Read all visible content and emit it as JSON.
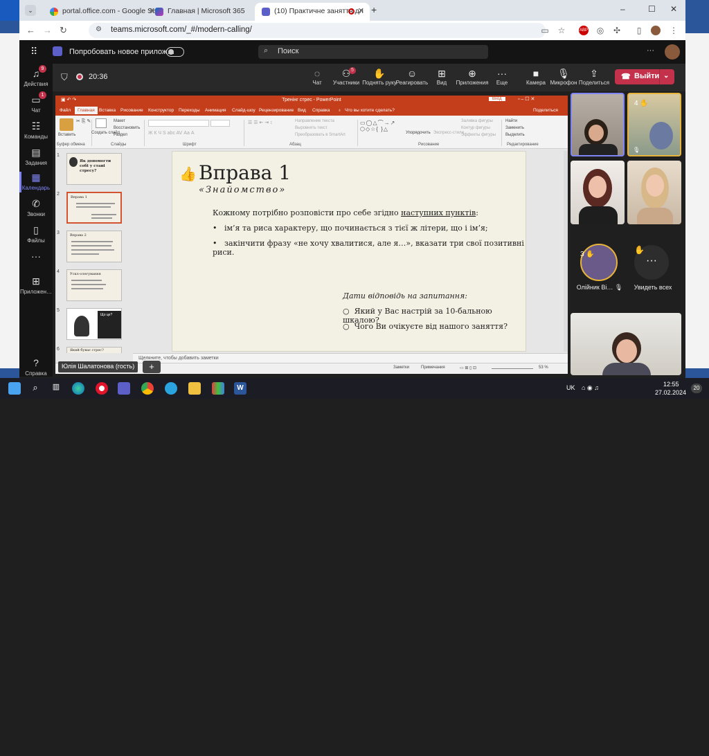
{
  "browser": {
    "tabs": [
      {
        "label": "portal.office.com - Google Sear",
        "icon": "google-icon"
      },
      {
        "label": "Главная | Microsoft 365",
        "icon": "microsoft365-icon"
      },
      {
        "label": "(10) Практичне заняття дл",
        "icon": "teams-icon"
      }
    ],
    "url": "teams.microsoft.com/_#/modern-calling/",
    "new_tab": "+",
    "win_min": "–",
    "win_max": "☐",
    "win_close": "✕"
  },
  "teams": {
    "try_new": "Попробовать новое прилож…",
    "search_placeholder": "Поиск",
    "rail": [
      {
        "label": "Действия",
        "badge": "9"
      },
      {
        "label": "Чат",
        "badge": "1"
      },
      {
        "label": "Команды",
        "badge": ""
      },
      {
        "label": "Задания",
        "badge": ""
      },
      {
        "label": "Календарь",
        "badge": ""
      },
      {
        "label": "Звонки",
        "badge": ""
      },
      {
        "label": "Файлы",
        "badge": ""
      },
      {
        "label": "",
        "badge": ""
      },
      {
        "label": "Приложен…",
        "badge": ""
      }
    ],
    "help": "Справка"
  },
  "meeting": {
    "timer": "20:36",
    "controls": [
      {
        "label": "Чат",
        "badge": ""
      },
      {
        "label": "Участники",
        "badge": "5"
      },
      {
        "label": "Поднять руку",
        "badge": ""
      },
      {
        "label": "Реагировать",
        "badge": ""
      },
      {
        "label": "Вид",
        "badge": ""
      },
      {
        "label": "Приложения",
        "badge": ""
      },
      {
        "label": "Еще",
        "badge": ""
      }
    ],
    "devices": [
      {
        "label": "Камера"
      },
      {
        "label": "Микрофон"
      },
      {
        "label": "Поделиться"
      }
    ],
    "leave": "Выйти",
    "presenter": "Юлія Шалатонова (гость)",
    "participants": [
      {
        "name": "",
        "badge": ""
      },
      {
        "name": "",
        "badge": "4"
      },
      {
        "name": "",
        "badge": ""
      },
      {
        "name": "",
        "badge": ""
      },
      {
        "name": "Олійник Ві…",
        "badge": "3"
      },
      {
        "name": "Увидеть всех",
        "badge": ""
      }
    ]
  },
  "ppt": {
    "title": "Тренінг стрес - PowerPoint",
    "login": "Вход",
    "share": "Поделиться",
    "tabs": [
      "Файл",
      "Главная",
      "Вставка",
      "Рисование",
      "Конструктор",
      "Переходы",
      "Анимация",
      "Слайд-шоу",
      "Рецензирование",
      "Вид",
      "Справка",
      "Что вы хотите сделать?"
    ],
    "ribbon_groups": [
      "Буфер обмена",
      "Слайды",
      "Шрифт",
      "Абзац",
      "Рисование",
      "Редактирование"
    ],
    "ribbon_items": {
      "paste": "Вставить",
      "new_slide": "Создать слайд",
      "layout": "Макет",
      "reset": "Восстановить",
      "section": "Раздел",
      "text_dir": "Направление текста",
      "align_text": "Выровнять текст",
      "smartart": "Преобразовать в SmartArt",
      "arrange": "Упорядочить",
      "quick_styles": "Экспресс-стили",
      "fill": "Заливка фигуры",
      "outline": "Контур фигуры",
      "effects": "Эффекты фигуры",
      "find": "Найти",
      "replace": "Заменить",
      "select": "Выделить"
    },
    "notes_placeholder": "Щелкните, чтобы добавить заметки",
    "status": {
      "notes": "Заметки",
      "comments": "Примечания",
      "zoom": "53 %"
    },
    "thumbnails": [
      {
        "num": "1",
        "title": "Як допомогти собі у стані стресу?"
      },
      {
        "num": "2",
        "title": "Вправа 1"
      },
      {
        "num": "3",
        "title": "Вправа 2"
      },
      {
        "num": "4",
        "title": "Ускл-олегування"
      },
      {
        "num": "5",
        "title": "Що це?"
      },
      {
        "num": "6",
        "title": "Який буває стрес?"
      }
    ],
    "slide": {
      "title": "Вправа 1",
      "subtitle": "«Знайомство»",
      "intro_a": "Кожному потрібно розповісти про себе згідно ",
      "intro_u": "наступних пунктів",
      "intro_b": ":",
      "bullets": [
        "ім’я та риса характеру, що починається з тієї ж літери, що і ім’я;",
        "закінчити фразу «не хочу хвалитися, але я…», вказати три свої позитивні риси."
      ],
      "question_head": "Дати відповідь на запитання:",
      "questions": [
        "Який у Вас настрій за 10-бальною шкалою?",
        "Чого Ви очікуєте від нашого заняття?"
      ]
    }
  },
  "taskbar": {
    "lang": "UK",
    "time": "12:55",
    "date": "27.02.2024",
    "notif": "20"
  },
  "colors": {
    "ppt_accent": "#c43e1c",
    "teams_leave": "#c4314b",
    "teams_accent": "#7f85f5"
  }
}
